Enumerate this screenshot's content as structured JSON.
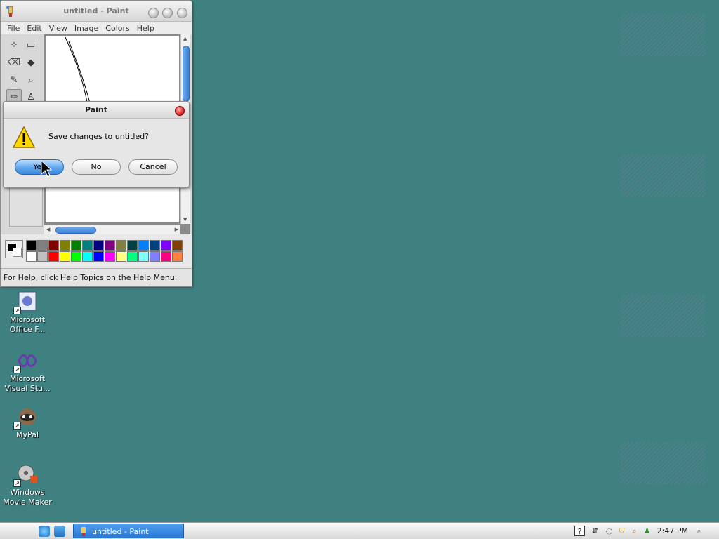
{
  "paint_window": {
    "title": "untitled - Paint",
    "menu": [
      "File",
      "Edit",
      "View",
      "Image",
      "Colors",
      "Help"
    ],
    "status_text": "For Help, click Help Topics on the Help Menu.",
    "palette_colors": [
      "#000000",
      "#808080",
      "#800000",
      "#808000",
      "#008000",
      "#008080",
      "#000080",
      "#800080",
      "#808040",
      "#004040",
      "#0080ff",
      "#004080",
      "#8000ff",
      "#804000",
      "#ffffff",
      "#c0c0c0",
      "#ff0000",
      "#ffff00",
      "#00ff00",
      "#00ffff",
      "#0000ff",
      "#ff00ff",
      "#ffff80",
      "#00ff80",
      "#80ffff",
      "#8080ff",
      "#ff0080",
      "#ff8040"
    ]
  },
  "dialog": {
    "title": "Paint",
    "message": "Save changes to untitled?",
    "buttons": {
      "yes": "Yes",
      "no": "No",
      "cancel": "Cancel"
    }
  },
  "desktop_icons": [
    {
      "label": "Microsoft Office F...",
      "icon": "office-icon"
    },
    {
      "label": "Microsoft Visual Stu...",
      "icon": "visual-studio-icon"
    },
    {
      "label": "MyPal",
      "icon": "raccoon-icon"
    },
    {
      "label": "Windows Movie Maker",
      "icon": "movie-maker-icon"
    }
  ],
  "taskbar": {
    "active_task": "untitled - Paint",
    "clock": "2:47 PM"
  },
  "colors": {
    "desktop": "#3f8080",
    "accent": "#2a78d6"
  }
}
